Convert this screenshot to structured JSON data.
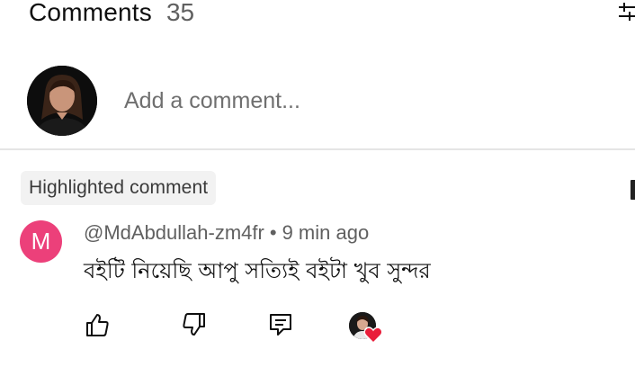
{
  "header": {
    "title": "Comments",
    "count": "35",
    "sort_icon": "sort-icon"
  },
  "add_comment": {
    "placeholder": "Add a comment..."
  },
  "highlighted": {
    "label": "Highlighted comment"
  },
  "comment": {
    "avatar_letter": "M",
    "avatar_color": "#ec407a",
    "author": "@MdAbdullah-zm4fr",
    "separator": "•",
    "time": "9 min ago",
    "text": "বইটি নিয়েছি আপু সত্যিই বইটা খুব সুন্দর",
    "actions": [
      "thumbs-up-icon",
      "thumbs-down-icon",
      "reply-icon",
      "creator-heart-icon"
    ]
  },
  "colors": {
    "heart": "#e91e3a",
    "divider": "#e5e5e5",
    "badge_bg": "#f2f2f2"
  }
}
